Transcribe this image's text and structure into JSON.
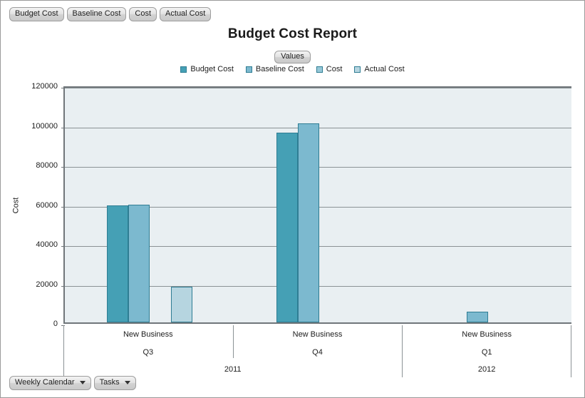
{
  "window": {
    "background": "#ffffff",
    "border_color": "#9a9a9a"
  },
  "top_tags": [
    {
      "label": "Budget Cost"
    },
    {
      "label": "Baseline Cost"
    },
    {
      "label": "Cost"
    },
    {
      "label": "Actual Cost"
    }
  ],
  "bottom_tags": [
    {
      "label": "Weekly Calendar",
      "has_caret": true
    },
    {
      "label": "Tasks",
      "has_caret": true
    }
  ],
  "legend_group_label": "Values",
  "chart_data": {
    "type": "bar",
    "title": "Budget Cost Report",
    "xlabel": "",
    "ylabel": "Cost",
    "ylim": [
      0,
      120000
    ],
    "ytick_values": [
      0,
      20000,
      40000,
      60000,
      80000,
      100000,
      120000
    ],
    "ytick_labels": [
      "0",
      "20000",
      "40000",
      "60000",
      "80000",
      "100000",
      "120000"
    ],
    "grid": true,
    "legend_position": "top",
    "plot_background": "#e9eff2",
    "categories": [
      {
        "l1": "New Business",
        "l2": "Q3",
        "year": "2011"
      },
      {
        "l1": "New Business",
        "l2": "Q4",
        "year": "2011"
      },
      {
        "l1": "New Business",
        "l2": "Q1",
        "year": "2012"
      }
    ],
    "year_groups": [
      {
        "label": "2011",
        "span": 2
      },
      {
        "label": "2012",
        "span": 1
      }
    ],
    "series": [
      {
        "name": "Budget Cost",
        "color": "#45a0b5",
        "values": [
          59000,
          96000,
          null
        ]
      },
      {
        "name": "Baseline Cost",
        "color": "#7cb9cf",
        "values": [
          59500,
          100500,
          5500
        ]
      },
      {
        "name": "Cost",
        "color": "#96c8d8",
        "values": [
          null,
          null,
          null
        ]
      },
      {
        "name": "Actual Cost",
        "color": "#b6d5e0",
        "values": [
          18000,
          null,
          null
        ]
      }
    ]
  }
}
